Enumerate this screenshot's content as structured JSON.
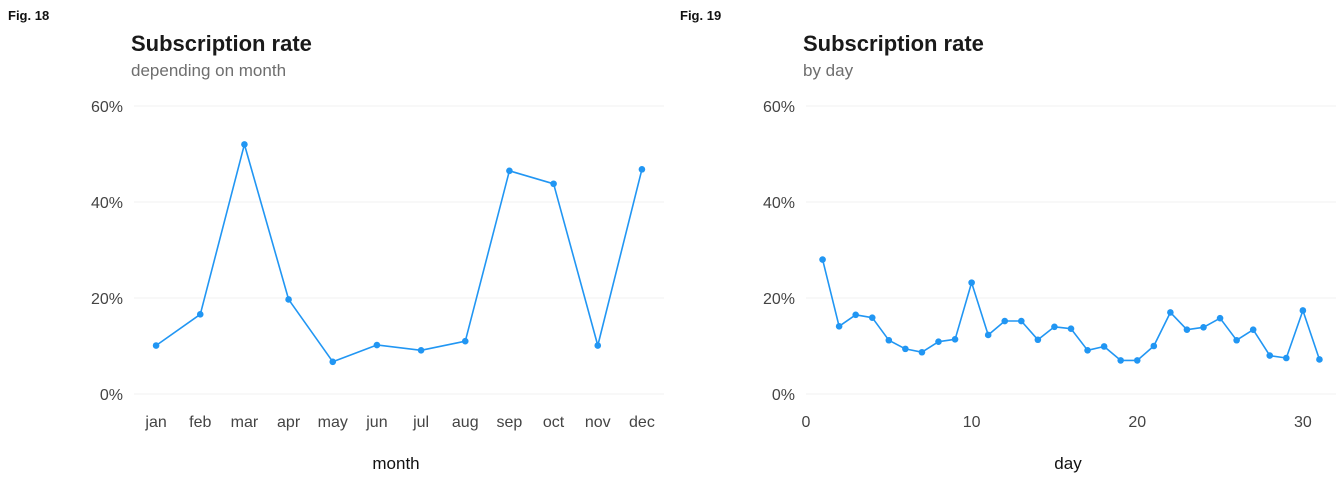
{
  "figures": [
    {
      "fig_label": "Fig. 18",
      "title": "Subscription rate",
      "subtitle": "depending on month"
    },
    {
      "fig_label": "Fig. 19",
      "title": "Subscription rate",
      "subtitle": "by day"
    }
  ],
  "colors": {
    "line": "#2196F3",
    "grid": "#f2f2f2",
    "text": "#444444"
  },
  "chart_data": [
    {
      "type": "line",
      "title": "Subscription rate",
      "subtitle": "depending on month",
      "xlabel": "month",
      "ylabel": "",
      "categories": [
        "jan",
        "feb",
        "mar",
        "apr",
        "may",
        "jun",
        "jul",
        "aug",
        "sep",
        "oct",
        "nov",
        "dec"
      ],
      "values": [
        0.101,
        0.166,
        0.52,
        0.197,
        0.067,
        0.102,
        0.091,
        0.11,
        0.465,
        0.438,
        0.101,
        0.468
      ],
      "ylim": [
        0,
        0.6
      ],
      "yticks": [
        0,
        0.2,
        0.4,
        0.6
      ],
      "ytick_labels": [
        "0%",
        "20%",
        "40%",
        "60%"
      ],
      "grid": true,
      "markers": true
    },
    {
      "type": "line",
      "title": "Subscription rate",
      "subtitle": "by day",
      "xlabel": "day",
      "ylabel": "",
      "x": [
        1,
        2,
        3,
        4,
        5,
        6,
        7,
        8,
        9,
        10,
        11,
        12,
        13,
        14,
        15,
        16,
        17,
        18,
        19,
        20,
        21,
        22,
        23,
        24,
        25,
        26,
        27,
        28,
        29,
        30,
        31
      ],
      "values": [
        0.28,
        0.141,
        0.165,
        0.159,
        0.112,
        0.094,
        0.087,
        0.109,
        0.114,
        0.232,
        0.123,
        0.152,
        0.152,
        0.113,
        0.14,
        0.136,
        0.091,
        0.099,
        0.07,
        0.07,
        0.1,
        0.17,
        0.134,
        0.139,
        0.158,
        0.112,
        0.134,
        0.08,
        0.075,
        0.174,
        0.072
      ],
      "xlim": [
        0,
        32
      ],
      "xticks": [
        0,
        10,
        20,
        30
      ],
      "ylim": [
        0,
        0.6
      ],
      "yticks": [
        0,
        0.2,
        0.4,
        0.6
      ],
      "ytick_labels": [
        "0%",
        "20%",
        "40%",
        "60%"
      ],
      "grid": true,
      "markers": true
    }
  ]
}
